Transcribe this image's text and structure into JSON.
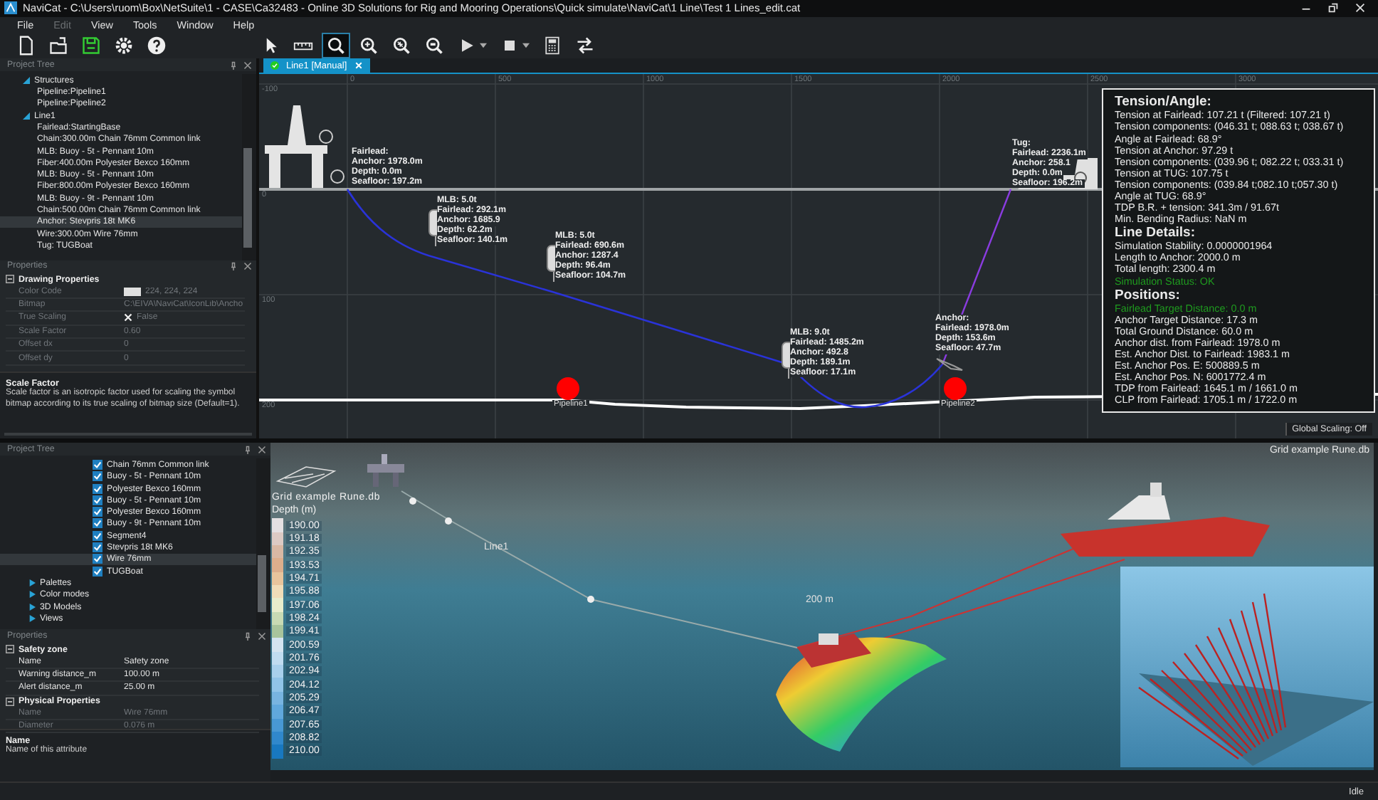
{
  "window": {
    "title": "NaviCat - C:\\Users\\ruom\\Box\\NetSuite\\1 - CASE\\Ca32483 - Online 3D Solutions for Rig and Mooring Operations\\Quick simulate\\NaviCat\\1 Line\\Test 1 Lines_edit.cat"
  },
  "menu": [
    {
      "label": "File",
      "disabled": false
    },
    {
      "label": "Edit",
      "disabled": true
    },
    {
      "label": "View",
      "disabled": false
    },
    {
      "label": "Tools",
      "disabled": false
    },
    {
      "label": "Window",
      "disabled": false
    },
    {
      "label": "Help",
      "disabled": false
    }
  ],
  "toolbar": {
    "file_tools": [
      {
        "kind": "new",
        "selected": false,
        "dropdown": false
      },
      {
        "kind": "open",
        "selected": false,
        "dropdown": false
      },
      {
        "kind": "save",
        "selected": false,
        "dropdown": false
      },
      {
        "kind": "settings",
        "selected": false,
        "dropdown": false
      },
      {
        "kind": "help",
        "selected": false,
        "dropdown": false
      }
    ],
    "view_tools": [
      {
        "kind": "pointer",
        "selected": false,
        "dropdown": false
      },
      {
        "kind": "ruler",
        "selected": false,
        "dropdown": false
      },
      {
        "kind": "zoom",
        "selected": true,
        "dropdown": false
      },
      {
        "kind": "zoom-in",
        "selected": false,
        "dropdown": false
      },
      {
        "kind": "zoom-extent",
        "selected": false,
        "dropdown": false
      },
      {
        "kind": "zoom-window",
        "selected": false,
        "dropdown": false
      },
      {
        "kind": "play",
        "selected": false,
        "dropdown": true
      },
      {
        "kind": "stop",
        "selected": false,
        "dropdown": true
      },
      {
        "kind": "calculator",
        "selected": false,
        "dropdown": false
      },
      {
        "kind": "swap",
        "selected": false,
        "dropdown": false
      }
    ]
  },
  "project_tree": {
    "title": "Project Tree",
    "items": [
      {
        "label": "Structures",
        "expanded": true,
        "selected": false,
        "children": [
          {
            "label": "Pipeline:Pipeline1",
            "selected": false
          },
          {
            "label": "Pipeline:Pipeline2",
            "selected": false
          }
        ]
      },
      {
        "label": "Line1",
        "expanded": true,
        "selected": false,
        "children": [
          {
            "label": "Fairlead:StartingBase",
            "selected": false
          },
          {
            "label": "Chain:300.00m Chain 76mm Common link",
            "selected": false
          },
          {
            "label": "MLB: Buoy - 5t - Pennant 10m",
            "selected": false
          },
          {
            "label": "Fiber:400.00m Polyester Bexco 160mm",
            "selected": false
          },
          {
            "label": "MLB: Buoy - 5t - Pennant 10m",
            "selected": false
          },
          {
            "label": "Fiber:800.00m Polyester Bexco 160mm",
            "selected": false
          },
          {
            "label": "MLB: Buoy - 9t - Pennant 10m",
            "selected": false
          },
          {
            "label": "Chain:500.00m Chain 76mm Common link",
            "selected": false
          },
          {
            "label": "Anchor: Stevpris 18t MK6",
            "selected": true
          },
          {
            "label": "Wire:300.00m Wire 76mm",
            "selected": false
          },
          {
            "label": "Tug: TUGBoat",
            "selected": false
          }
        ]
      }
    ]
  },
  "properties": {
    "title": "Properties",
    "sections": [
      {
        "title": "Drawing Properties",
        "expanded": true,
        "rows": [
          {
            "name": "Color Code",
            "value": "224, 224, 224",
            "kind": "color",
            "disabled": true
          },
          {
            "name": "Bitmap",
            "value": "C:\\EIVA\\NaviCat\\IconLib\\Ancho",
            "disabled": true
          },
          {
            "name": "True Scaling",
            "value": "False",
            "kind": "bool",
            "checked": false,
            "disabled": true
          },
          {
            "name": "Scale Factor",
            "value": "0.60",
            "disabled": true
          },
          {
            "name": "Offset dx",
            "value": "0",
            "disabled": true
          },
          {
            "name": "Offset dy",
            "value": "0",
            "disabled": true
          }
        ]
      }
    ]
  },
  "description": {
    "title": "Scale Factor",
    "text": "Scale factor is an isotropic factor used for scaling the symbol bitmap according to its true scaling of bitmap size (Default=1)."
  },
  "document_tab": {
    "label": "Line1 [Manual]"
  },
  "profile_view": {
    "x_ticks": [
      "0",
      "500",
      "1000",
      "1500",
      "2000",
      "2500",
      "3000"
    ],
    "y_ticks": [
      "-100",
      "0",
      "100",
      "200"
    ],
    "annotations": [
      {
        "kind": "fairlead",
        "lines": [
          "Fairlead:",
          "Anchor: 1978.0m",
          "Depth: 0.0m",
          "Seafloor: 197.2m"
        ]
      },
      {
        "kind": "buoy",
        "lines": [
          "MLB: 5.0t",
          "Fairlead: 292.1m",
          "Anchor: 1685.9",
          "Depth: 62.2m",
          "Seafloor: 140.1m"
        ]
      },
      {
        "kind": "buoy",
        "lines": [
          "MLB: 5.0t",
          "Fairlead: 690.6m",
          "Anchor: 1287.4",
          "Depth: 96.4m",
          "Seafloor: 104.7m"
        ]
      },
      {
        "kind": "buoy",
        "lines": [
          "MLB: 9.0t",
          "Fairlead: 1485.2m",
          "Anchor: 492.8",
          "Depth: 189.1m",
          "Seafloor: 17.1m"
        ]
      },
      {
        "kind": "anchor",
        "lines": [
          "Anchor:",
          "Fairlead: 1978.0m",
          "Depth: 153.6m",
          "Seafloor: 47.7m"
        ]
      },
      {
        "kind": "tug",
        "lines": [
          "Tug:",
          "Fairlead: 2236.1m",
          "Anchor: 258.1",
          "Depth: 0.0m",
          "Seafloor: 196.2m"
        ]
      }
    ],
    "pipelines": [
      {
        "label": "Pipeline1"
      },
      {
        "label": "Pipeline2"
      }
    ],
    "info_panel": [
      {
        "kind": "heading",
        "text": "Tension/Angle:"
      },
      {
        "kind": "text",
        "text": "Tension at Fairlead: 107.21 t (Filtered: 107.21 t)"
      },
      {
        "kind": "text",
        "text": "Tension components: (046.31 t; 088.63 t; 038.67 t)"
      },
      {
        "kind": "text",
        "text": "Angle at Fairlead: 68.9°"
      },
      {
        "kind": "text",
        "text": "Tension at Anchor: 97.29 t"
      },
      {
        "kind": "text",
        "text": "Tension components: (039.96 t; 082.22 t; 033.31 t)"
      },
      {
        "kind": "text",
        "text": "Tension at TUG: 107.75 t"
      },
      {
        "kind": "text",
        "text": "Tension components: (039.84 t;082.10 t;057.30 t)"
      },
      {
        "kind": "text",
        "text": "Angle at TUG: 68.9°"
      },
      {
        "kind": "text",
        "text": "TDP B.R. + tension: 341.3m / 91.67t"
      },
      {
        "kind": "text",
        "text": "Min. Bending Radius: NaN m"
      },
      {
        "kind": "heading",
        "text": "Line Details:"
      },
      {
        "kind": "text",
        "text": "Simulation Stability: 0.0000001964"
      },
      {
        "kind": "text",
        "text": "Length to Anchor: 2000.0 m"
      },
      {
        "kind": "text",
        "text": "Total length: 2300.4 m"
      },
      {
        "kind": "ok",
        "text": "Simulation Status: OK"
      },
      {
        "kind": "heading",
        "text": "Positions:"
      },
      {
        "kind": "ok",
        "text": "Fairlead Target Distance: 0.0 m"
      },
      {
        "kind": "text",
        "text": "Anchor Target Distance: 17.3 m"
      },
      {
        "kind": "text",
        "text": "Total Ground Distance: 60.0 m"
      },
      {
        "kind": "text",
        "text": "Anchor dist. from Fairlead: 1978.0 m"
      },
      {
        "kind": "text",
        "text": "Est. Anchor Dist. to Fairlead: 1983.1 m"
      },
      {
        "kind": "text",
        "text": "Est. Anchor Pos. E: 500889.5 m"
      },
      {
        "kind": "text",
        "text": "Est. Anchor Pos. N: 6001772.4 m"
      },
      {
        "kind": "text",
        "text": "TDP from Fairlead: 1645.1 m / 1661.0 m"
      },
      {
        "kind": "text",
        "text": "CLP from Fairlead: 1705.1 m / 1722.0 m"
      }
    ],
    "status": "Global Scaling: Off"
  },
  "layers_tree": {
    "title": "Project Tree",
    "layers": [
      {
        "label": "Chain 76mm Common link",
        "checked": true,
        "selected": false
      },
      {
        "label": "Buoy - 5t - Pennant 10m",
        "checked": true,
        "selected": false
      },
      {
        "label": "Polyester Bexco 160mm",
        "checked": true,
        "selected": false
      },
      {
        "label": "Buoy - 5t - Pennant 10m",
        "checked": true,
        "selected": false
      },
      {
        "label": "Polyester Bexco 160mm",
        "checked": true,
        "selected": false
      },
      {
        "label": "Buoy - 9t - Pennant 10m",
        "checked": true,
        "selected": false
      },
      {
        "label": "Segment4",
        "checked": true,
        "selected": false
      },
      {
        "label": "Stevpris 18t MK6",
        "checked": true,
        "selected": false
      },
      {
        "label": "Wire 76mm",
        "checked": true,
        "selected": true
      },
      {
        "label": "TUGBoat",
        "checked": true,
        "selected": false
      }
    ],
    "folders": [
      {
        "label": "Palettes",
        "expanded": false
      },
      {
        "label": "Color modes",
        "expanded": false
      },
      {
        "label": "3D Models",
        "expanded": false
      },
      {
        "label": "Views",
        "expanded": false
      }
    ]
  },
  "layer_properties": {
    "title": "Properties",
    "sections": [
      {
        "title": "Safety zone",
        "expanded": true,
        "rows": [
          {
            "name": "Name",
            "value": "Safety zone",
            "disabled": false
          },
          {
            "name": "Warning distance_m",
            "value": "100.00 m",
            "disabled": false
          },
          {
            "name": "Alert distance_m",
            "value": "25.00 m",
            "disabled": false
          }
        ]
      },
      {
        "title": "Physical Properties",
        "expanded": true,
        "rows": [
          {
            "name": "Name",
            "value": "Wire 76mm",
            "disabled": true
          },
          {
            "name": "Diameter",
            "value": "0.076 m",
            "disabled": true
          }
        ]
      }
    ]
  },
  "layer_description": {
    "title": "Name",
    "text": "Name of this attribute"
  },
  "scene_view": {
    "grid_title": "Grid example Rune.db",
    "grid_label": "Grid example Rune.db",
    "line_label": "Line1",
    "scale_label": "200 m",
    "legend": {
      "title": "Depth (m)",
      "items": [
        {
          "label": "190.00",
          "color": "#e4e0e2"
        },
        {
          "label": "191.18",
          "color": "#dccac4"
        },
        {
          "label": "192.35",
          "color": "#d8b8a4"
        },
        {
          "label": "193.53",
          "color": "#dcae8c"
        },
        {
          "label": "194.71",
          "color": "#e8c49c"
        },
        {
          "label": "195.88",
          "color": "#f0dcb8"
        },
        {
          "label": "197.06",
          "color": "#e8eccc"
        },
        {
          "label": "198.24",
          "color": "#c8dab4"
        },
        {
          "label": "199.41",
          "color": "#a8c49c"
        },
        {
          "label": "200.59",
          "color": "#d4e4f0"
        },
        {
          "label": "201.76",
          "color": "#c0dcf0"
        },
        {
          "label": "202.94",
          "color": "#a8d0ec"
        },
        {
          "label": "204.12",
          "color": "#90c4e8"
        },
        {
          "label": "205.29",
          "color": "#78b4e0"
        },
        {
          "label": "206.47",
          "color": "#60a8dc"
        },
        {
          "label": "207.65",
          "color": "#4898d4"
        },
        {
          "label": "208.82",
          "color": "#3088cc"
        },
        {
          "label": "210.00",
          "color": "#1878c0"
        }
      ]
    }
  },
  "status_bar": {
    "text": "Idle"
  }
}
